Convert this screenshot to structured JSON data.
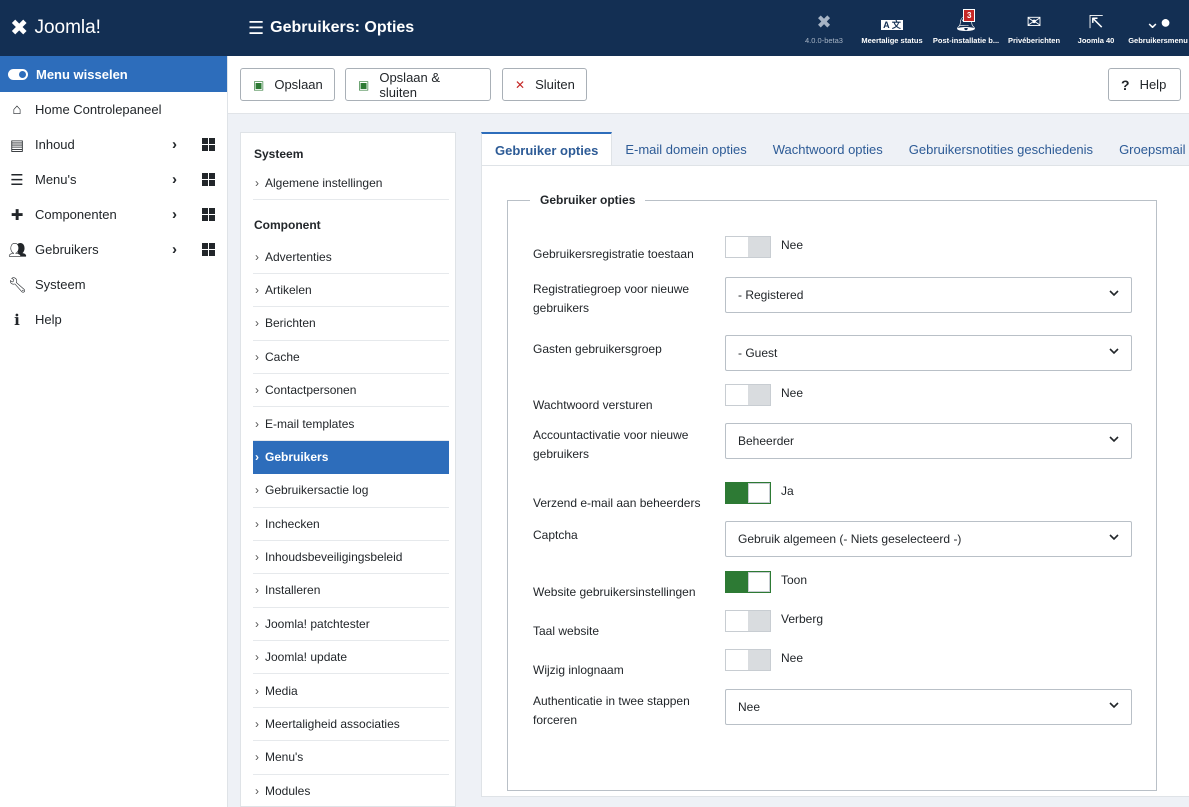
{
  "header": {
    "logo_text": "Joomla!",
    "page_title": "Gebruikers: Opties",
    "items": [
      {
        "label": "4.0.0-beta3"
      },
      {
        "label": "Meertalige status"
      },
      {
        "label": "Post-installatie b...",
        "badge": "3"
      },
      {
        "label": "Privéberichten"
      },
      {
        "label": "Joomla 40"
      },
      {
        "label": "Gebruikersmenu"
      }
    ]
  },
  "sidebar": {
    "toggle_label": "Menu wisselen",
    "items": [
      {
        "label": "Home Controlepaneel"
      },
      {
        "label": "Inhoud"
      },
      {
        "label": "Menu's"
      },
      {
        "label": "Componenten"
      },
      {
        "label": "Gebruikers"
      },
      {
        "label": "Systeem"
      },
      {
        "label": "Help"
      }
    ]
  },
  "toolbar": {
    "save": "Opslaan",
    "save_close": "Opslaan & sluiten",
    "close": "Sluiten",
    "help": "Help"
  },
  "optnav": {
    "section_system": "Systeem",
    "system_items": [
      "Algemene instellingen"
    ],
    "section_component": "Component",
    "component_items": [
      "Advertenties",
      "Artikelen",
      "Berichten",
      "Cache",
      "Contactpersonen",
      "E-mail templates",
      "Gebruikers",
      "Gebruikersactie log",
      "Inchecken",
      "Inhoudsbeveiligingsbeleid",
      "Installeren",
      "Joomla! patchtester",
      "Joomla! update",
      "Media",
      "Meertaligheid associaties",
      "Menu's",
      "Modules"
    ],
    "active": "Gebruikers"
  },
  "tabs": [
    "Gebruiker opties",
    "E-mail domein opties",
    "Wachtwoord opties",
    "Gebruikersnotities geschiedenis",
    "Groepsmail geb"
  ],
  "form": {
    "legend": "Gebruiker opties",
    "fields": [
      {
        "label": "Gebruikersregistratie toestaan",
        "type": "switch",
        "on": false,
        "value": "Nee"
      },
      {
        "label": "Registratiegroep voor nieuwe gebruikers",
        "type": "select",
        "value": "- Registered"
      },
      {
        "label": "Gasten gebruikersgroep",
        "type": "select",
        "value": "- Guest"
      },
      {
        "label": "Wachtwoord versturen",
        "type": "switch",
        "on": false,
        "value": "Nee"
      },
      {
        "label": "Accountactivatie voor nieuwe gebruikers",
        "type": "select",
        "value": "Beheerder"
      },
      {
        "label": "Verzend e-mail aan beheerders",
        "type": "switch",
        "on": true,
        "value": "Ja"
      },
      {
        "label": "Captcha",
        "type": "select",
        "value": "Gebruik algemeen (- Niets geselecteerd -)"
      },
      {
        "label": "Website gebruikersinstellingen",
        "type": "switch",
        "on": true,
        "value": "Toon"
      },
      {
        "label": "Taal website",
        "type": "switch",
        "on": false,
        "value": "Verberg"
      },
      {
        "label": "Wijzig inlognaam",
        "type": "switch",
        "on": false,
        "value": "Nee"
      },
      {
        "label": "Authenticatie in twee stappen forceren",
        "type": "select",
        "value": "Nee"
      }
    ]
  },
  "colors": {
    "header_bg": "#132f53",
    "accent": "#2d6dbb",
    "switch_on": "#2d7a34"
  }
}
